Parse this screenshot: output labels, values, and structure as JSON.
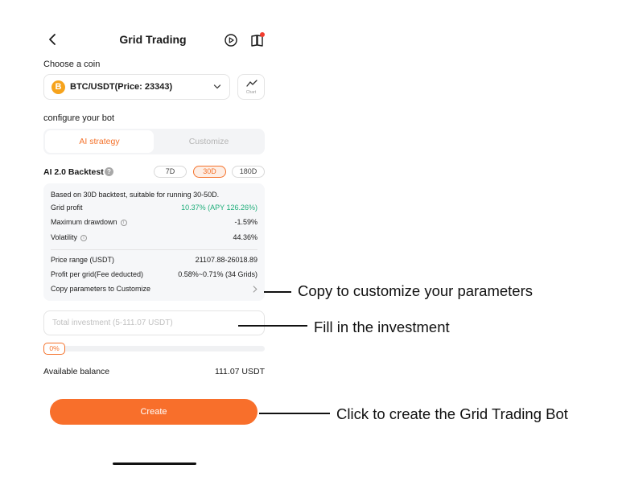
{
  "header": {
    "title": "Grid Trading",
    "back_icon": "chevron-left-icon",
    "play_icon": "play-circle-icon",
    "guide_icon": "book-icon",
    "notification_dot_color": "#f23c2e"
  },
  "coin": {
    "section_label": "Choose a coin",
    "selected": "BTC/USDT(Price: 23343)",
    "coin_symbol": "B",
    "coin_color": "#f6a31c",
    "chart_label": "Chart"
  },
  "bot": {
    "section_label": "configure your bot",
    "tabs": [
      {
        "label": "AI strategy",
        "active": true
      },
      {
        "label": "Customize",
        "active": false
      }
    ]
  },
  "backtest": {
    "title": "AI 2.0 Backtest",
    "periods": [
      {
        "label": "7D",
        "selected": false
      },
      {
        "label": "30D",
        "selected": true
      },
      {
        "label": "180D",
        "selected": false
      }
    ],
    "summary": "Based on 30D backtest, suitable for running 30-50D.",
    "grid_profit_label": "Grid profit",
    "grid_profit_value": "10.37% (APY 126.26%)",
    "max_drawdown_label": "Maximum drawdown",
    "max_drawdown_value": "-1.59%",
    "volatility_label": "Volatility",
    "volatility_value": "44.36%",
    "price_range_label": "Price range (USDT)",
    "price_range_value": "21107.88-26018.89",
    "profit_per_grid_label": "Profit per grid(Fee deducted)",
    "profit_per_grid_value": "0.58%~0.71% (34 Grids)",
    "copy_label": "Copy parameters to Customize"
  },
  "investment": {
    "value": "",
    "placeholder": "Total investment (5-111.07 USDT)",
    "percent": 0,
    "percent_label": "0%"
  },
  "balance": {
    "label": "Available balance",
    "value": "111.07 USDT"
  },
  "create_label": "Create",
  "colors": {
    "accent": "#f86f2b",
    "profit_green": "#1fae7a"
  },
  "annotations": {
    "copy": "Copy to customize your parameters",
    "invest": "Fill in the investment",
    "create": "Click to create the Grid Trading Bot"
  }
}
